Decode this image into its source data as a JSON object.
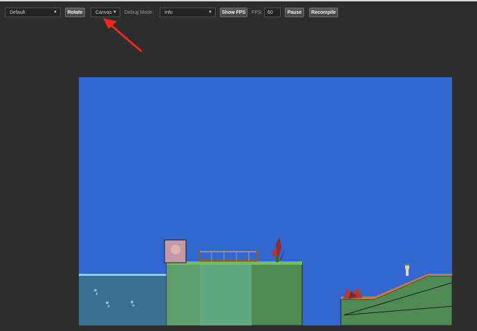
{
  "toolbar": {
    "preset_select": "Default",
    "rotate_button": "Rotate",
    "renderer_select": "Canvas",
    "debug_mode_label": "Debug Mode:",
    "debug_mode_select": "Info",
    "show_fps_button": "Show FPS",
    "fps_label": "FPS:",
    "fps_value": "60",
    "pause_button": "Pause",
    "recompile_button": "Recompile"
  },
  "colors": {
    "sky": "#3266d1",
    "water": "#3a6f91",
    "grass_platform": "#5a9c62",
    "annotation_arrow": "#f0281e"
  }
}
